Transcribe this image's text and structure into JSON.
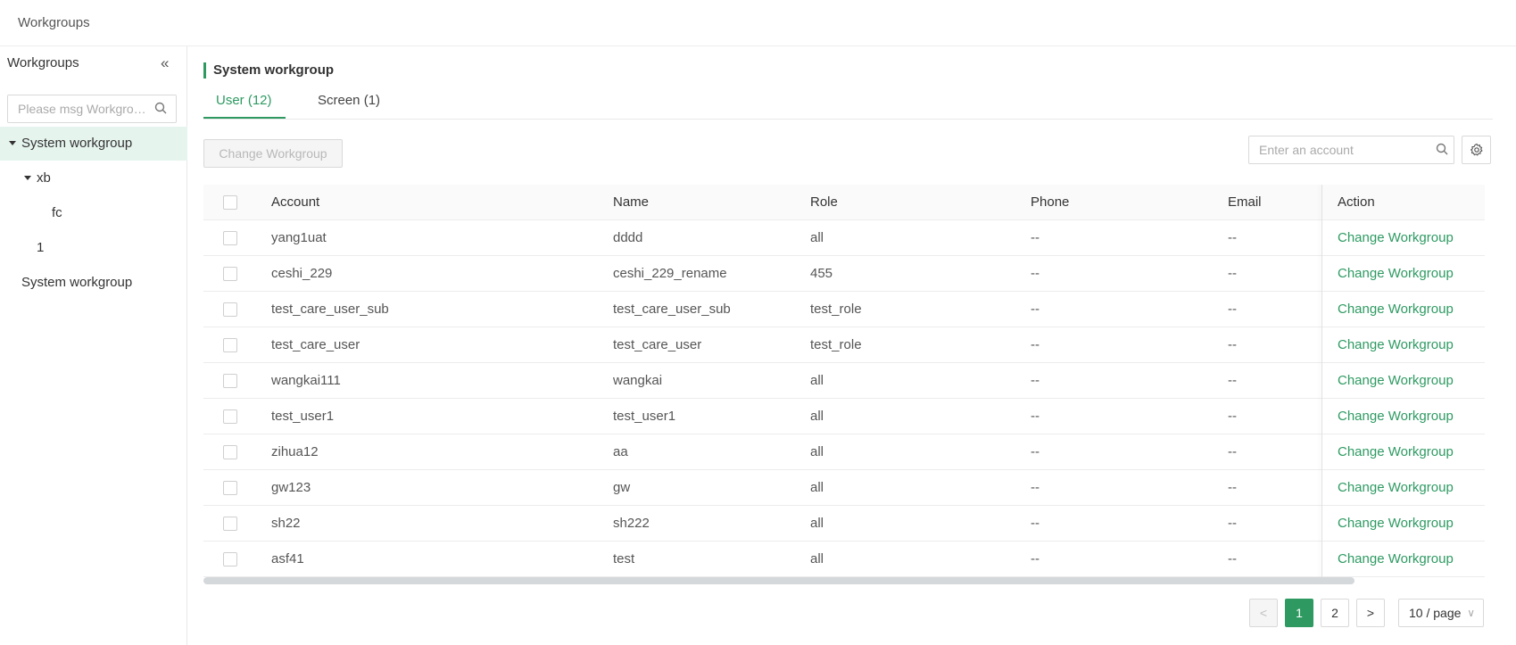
{
  "breadcrumb": "Workgroups",
  "sidebar": {
    "title": "Workgroups",
    "search_placeholder": "Please msg Workgro…",
    "tree": [
      {
        "label": "System workgroup",
        "level": 0,
        "expanded": true,
        "selected": true
      },
      {
        "label": "xb",
        "level": 1,
        "expanded": true,
        "selected": false
      },
      {
        "label": "fc",
        "level": 2,
        "expanded": false,
        "selected": false
      },
      {
        "label": "1",
        "level": 1,
        "expanded": false,
        "selected": false
      },
      {
        "label": "System workgroup",
        "level": 0,
        "expanded": false,
        "selected": false
      }
    ]
  },
  "main": {
    "section_title": "System workgroup",
    "tabs": [
      {
        "label": "User (12)",
        "active": true
      },
      {
        "label": "Screen (1)",
        "active": false
      }
    ],
    "change_button": "Change Workgroup",
    "account_search_placeholder": "Enter an account"
  },
  "table": {
    "columns": [
      "Account",
      "Name",
      "Role",
      "Phone",
      "Email",
      "Action"
    ],
    "rows": [
      {
        "account": "yang1uat",
        "name": "dddd",
        "role": "all",
        "phone": "--",
        "email": "--",
        "action": "Change Workgroup"
      },
      {
        "account": "ceshi_229",
        "name": "ceshi_229_rename",
        "role": "455",
        "phone": "--",
        "email": "--",
        "action": "Change Workgroup"
      },
      {
        "account": "test_care_user_sub",
        "name": "test_care_user_sub",
        "role": "test_role",
        "phone": "--",
        "email": "--",
        "action": "Change Workgroup"
      },
      {
        "account": "test_care_user",
        "name": "test_care_user",
        "role": "test_role",
        "phone": "--",
        "email": "--",
        "action": "Change Workgroup"
      },
      {
        "account": "wangkai111",
        "name": "wangkai",
        "role": "all",
        "phone": "--",
        "email": "--",
        "action": "Change Workgroup"
      },
      {
        "account": "test_user1",
        "name": "test_user1",
        "role": "all",
        "phone": "--",
        "email": "--",
        "action": "Change Workgroup"
      },
      {
        "account": "zihua12",
        "name": "aa",
        "role": "all",
        "phone": "--",
        "email": "--",
        "action": "Change Workgroup"
      },
      {
        "account": "gw123",
        "name": "gw",
        "role": "all",
        "phone": "--",
        "email": "--",
        "action": "Change Workgroup"
      },
      {
        "account": "sh22",
        "name": "sh222",
        "role": "all",
        "phone": "--",
        "email": "--",
        "action": "Change Workgroup"
      },
      {
        "account": "asf41",
        "name": "test",
        "role": "all",
        "phone": "--",
        "email": "--",
        "action": "Change Workgroup"
      }
    ]
  },
  "pagination": {
    "prev": "<",
    "pages": [
      "1",
      "2"
    ],
    "current": "1",
    "next": ">",
    "page_size": "10 / page"
  },
  "colors": {
    "accent": "#2e9a62",
    "selected_bg": "#e6f4ee"
  }
}
